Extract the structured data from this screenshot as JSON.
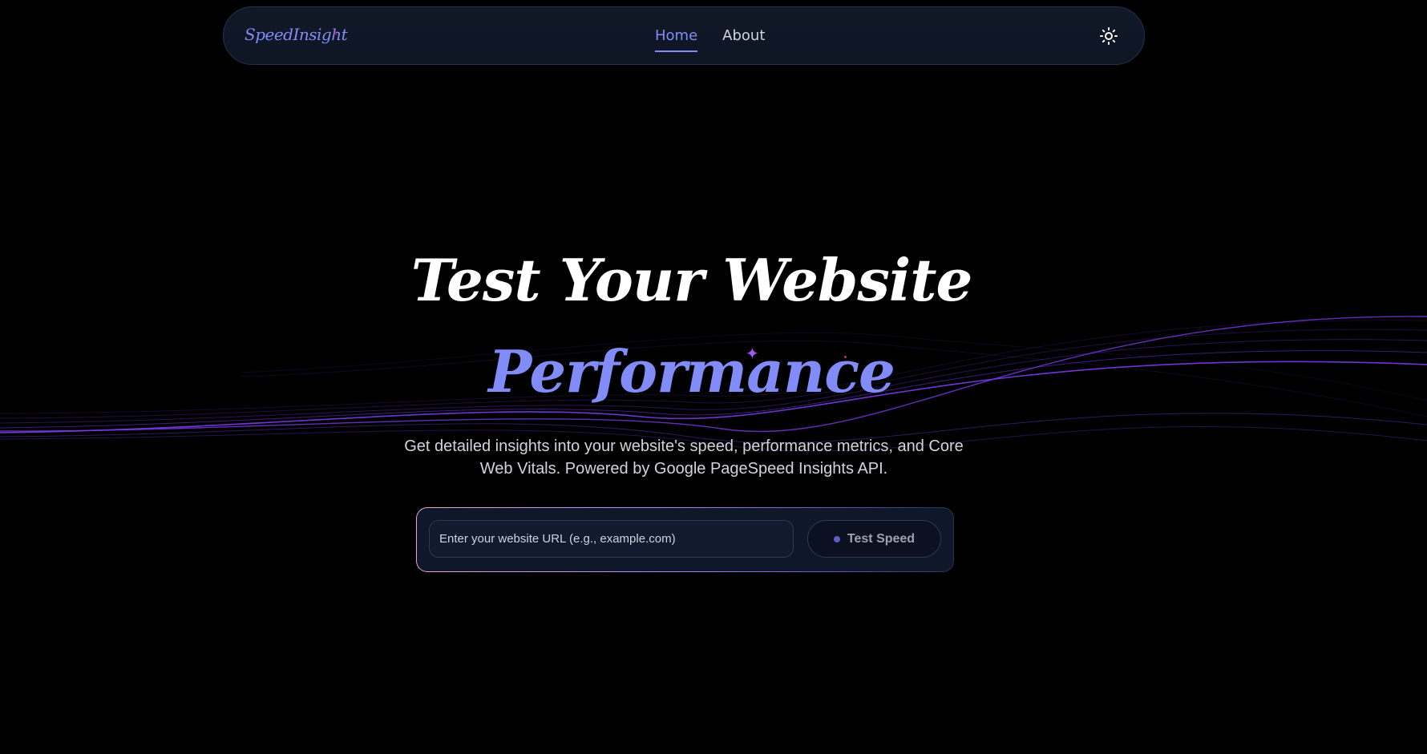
{
  "nav": {
    "logo": "SpeedInsight",
    "logo_mark": "×",
    "links": [
      {
        "label": "Home",
        "active": true
      },
      {
        "label": "About",
        "active": false
      }
    ],
    "theme_icon": "sun-icon"
  },
  "hero": {
    "title": "Test Your Website",
    "subtitle": "Performance",
    "description": "Get detailed insights into your website's speed, performance metrics, and Core Web Vitals. Powered by Google PageSpeed Insights API."
  },
  "form": {
    "placeholder": "Enter your website URL (e.g., example.com)",
    "value": "",
    "button_label": "Test Speed"
  },
  "colors": {
    "background": "#000000",
    "accent": "#818cf8",
    "wave": "#7c3aed",
    "navbar_bg": "#111827",
    "logo_mark": "#c0306f"
  }
}
